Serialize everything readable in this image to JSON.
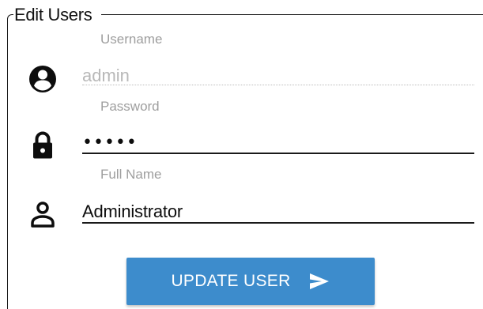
{
  "form": {
    "legend": "Edit Users",
    "fields": [
      {
        "label": "Username",
        "value": "admin",
        "icon": "user-circle-icon",
        "disabled": true
      },
      {
        "label": "Password",
        "value": "•••••",
        "icon": "lock-icon",
        "disabled": false
      },
      {
        "label": "Full Name",
        "value": "Administrator",
        "icon": "user-outline-icon",
        "disabled": false
      }
    ],
    "submit": {
      "label": "UPDATE USER",
      "icon": "send-icon"
    }
  },
  "colors": {
    "button_bg": "#3d8ccc",
    "button_text": "#ffffff",
    "label": "#9e9e9e",
    "disabled_value": "#b8b8b8",
    "text": "#0d0d0d"
  }
}
